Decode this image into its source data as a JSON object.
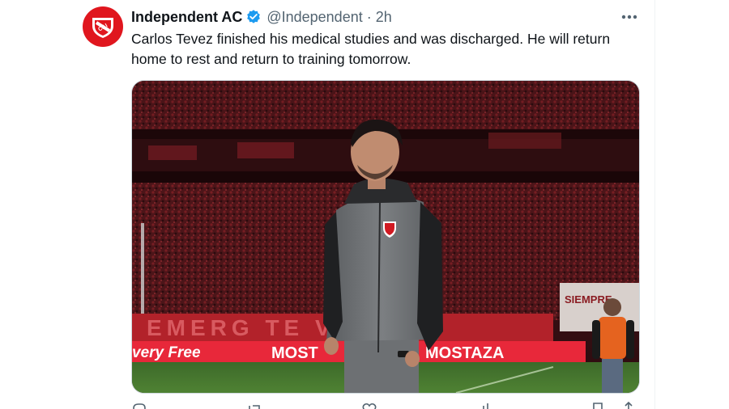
{
  "tweet": {
    "author": {
      "display_name": "Independent AC",
      "handle": "@Independent",
      "verified_icon": "verified-badge-icon",
      "avatar_icon": "club-crest-icon"
    },
    "separator": "·",
    "time": "2h",
    "more_icon": "more-options-icon",
    "text": "Carlos Tevez finished his medical studies and was discharged. He will return home to rest and return to training tomorrow.",
    "media": {
      "description_icon": "photo",
      "banner_left_text": "very Free",
      "banner_mid_text": "MOST",
      "banner_right_text": "MOSTAZA",
      "crowd_banner_text": "EMERG TE VIRE",
      "side_banner_text": "SIEMPRE"
    },
    "actions": {
      "reply_icon": "reply-icon",
      "retweet_icon": "retweet-icon",
      "like_icon": "like-icon",
      "views_icon": "views-icon",
      "bookmark_icon": "bookmark-icon",
      "share_icon": "share-icon"
    }
  },
  "colors": {
    "brand_red": "#e0161e",
    "verified_blue": "#1d9bf0",
    "text_primary": "#0f1419",
    "text_secondary": "#536471"
  }
}
